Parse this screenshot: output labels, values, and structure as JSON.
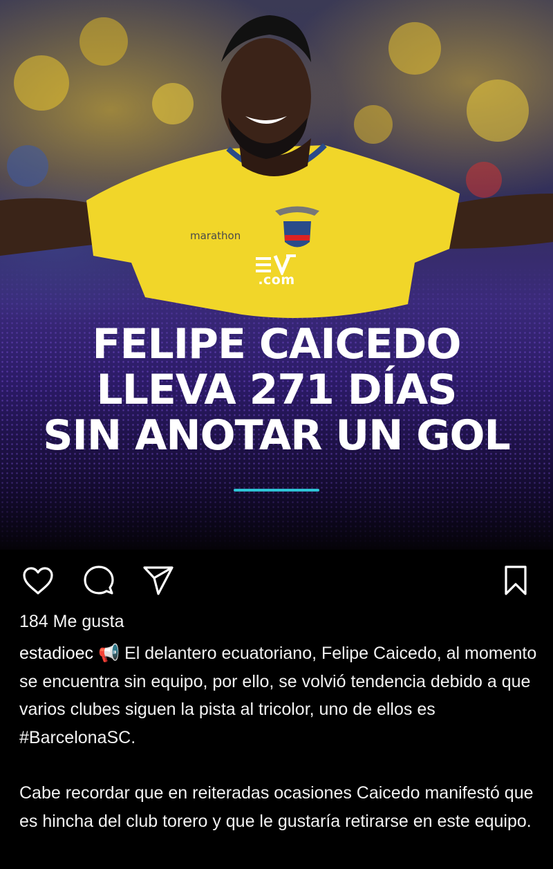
{
  "post": {
    "image": {
      "brand_text": ".com",
      "brand_mark": "EV logo",
      "headline": [
        "FELIPE CAICEDO",
        "LLEVA 271 DÍAS",
        "SIN ANOTAR UN GOL"
      ],
      "jersey_text": "marathon",
      "accent_color": "#2ec3d6"
    },
    "actions": {
      "like_icon": "heart-icon",
      "comment_icon": "comment-icon",
      "share_icon": "send-icon",
      "save_icon": "bookmark-icon"
    },
    "likes_text": "184 Me gusta",
    "caption": {
      "username": "estadioec",
      "emoji": "📢",
      "text_1": "El delantero ecuatoriano, Felipe Caicedo, al momento se encuentra sin equipo, por ello, se volvió tendencia debido a que varios clubes siguen la pista al tricolor, uno de ellos es",
      "hashtag": "#BarcelonaSC",
      "text_1_end": ".",
      "text_2": "Cabe recordar que en reiteradas ocasiones Caicedo manifestó que es hincha del club torero y que le gustaría retirarse en este equipo."
    }
  }
}
